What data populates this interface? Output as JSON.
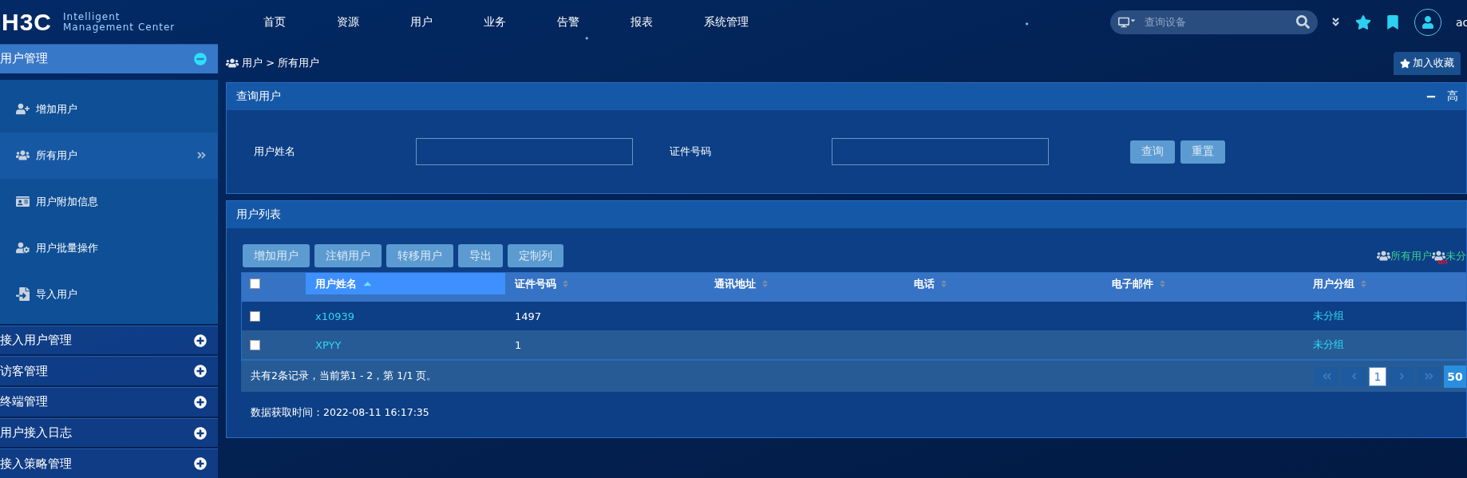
{
  "header": {
    "logo": "H3C",
    "logo_lines": [
      "Intelligent",
      "Management Center"
    ],
    "nav": [
      "首页",
      "资源",
      "用户",
      "业务",
      "告警",
      "报表",
      "系统管理"
    ],
    "search": {
      "placeholder": "查询设备"
    },
    "user": "ac"
  },
  "sidebar": {
    "groups": [
      {
        "label": "用户管理",
        "expanded": true,
        "children": [
          {
            "label": "增加用户",
            "selected": false
          },
          {
            "label": "所有用户",
            "selected": true
          },
          {
            "label": "用户附加信息",
            "selected": false
          },
          {
            "label": "用户批量操作",
            "selected": false
          },
          {
            "label": "导入用户",
            "selected": false
          }
        ]
      },
      {
        "label": "接入用户管理",
        "expanded": false
      },
      {
        "label": "访客管理",
        "expanded": false
      },
      {
        "label": "终端管理",
        "expanded": false
      },
      {
        "label": "用户接入日志",
        "expanded": false
      },
      {
        "label": "接入策略管理",
        "expanded": false
      }
    ]
  },
  "breadcrumb": "用户 > 所有用户",
  "favorite_button": "加入收藏",
  "query_panel": {
    "title": "查询用户",
    "advanced": "高",
    "fields": [
      {
        "label": "用户姓名"
      },
      {
        "label": "证件号码"
      }
    ],
    "buttons": [
      "查询",
      "重置"
    ]
  },
  "list_panel": {
    "title": "用户列表",
    "toolbar": [
      "增加用户",
      "注销用户",
      "转移用户",
      "导出",
      "定制列"
    ],
    "filters": [
      {
        "label": "所有用户"
      },
      {
        "label": "未分",
        "badge": "un"
      }
    ],
    "table": {
      "all_checked": false,
      "columns": [
        {
          "label": "用户姓名",
          "sorted": true
        },
        {
          "label": "证件号码",
          "sorted": false
        },
        {
          "label": "通讯地址",
          "sorted": false
        },
        {
          "label": "电话",
          "sorted": false
        },
        {
          "label": "电子邮件",
          "sorted": false
        },
        {
          "label": "用户分组",
          "sorted": false
        }
      ],
      "rows": [
        {
          "checked": false,
          "name": "x10939",
          "id_number": "1497",
          "group": "未分组"
        },
        {
          "checked": false,
          "name": "XPYY",
          "id_number": "1",
          "group": "未分组"
        }
      ]
    },
    "summary": "共有2条记录，当前第1 - 2，第 1/1 页。",
    "pagination": {
      "pages": [
        {
          "label": "1",
          "selected": true
        }
      ],
      "page_size": "50"
    }
  },
  "fetch_time": "数据获取时间：2022-08-11 16:17:35"
}
